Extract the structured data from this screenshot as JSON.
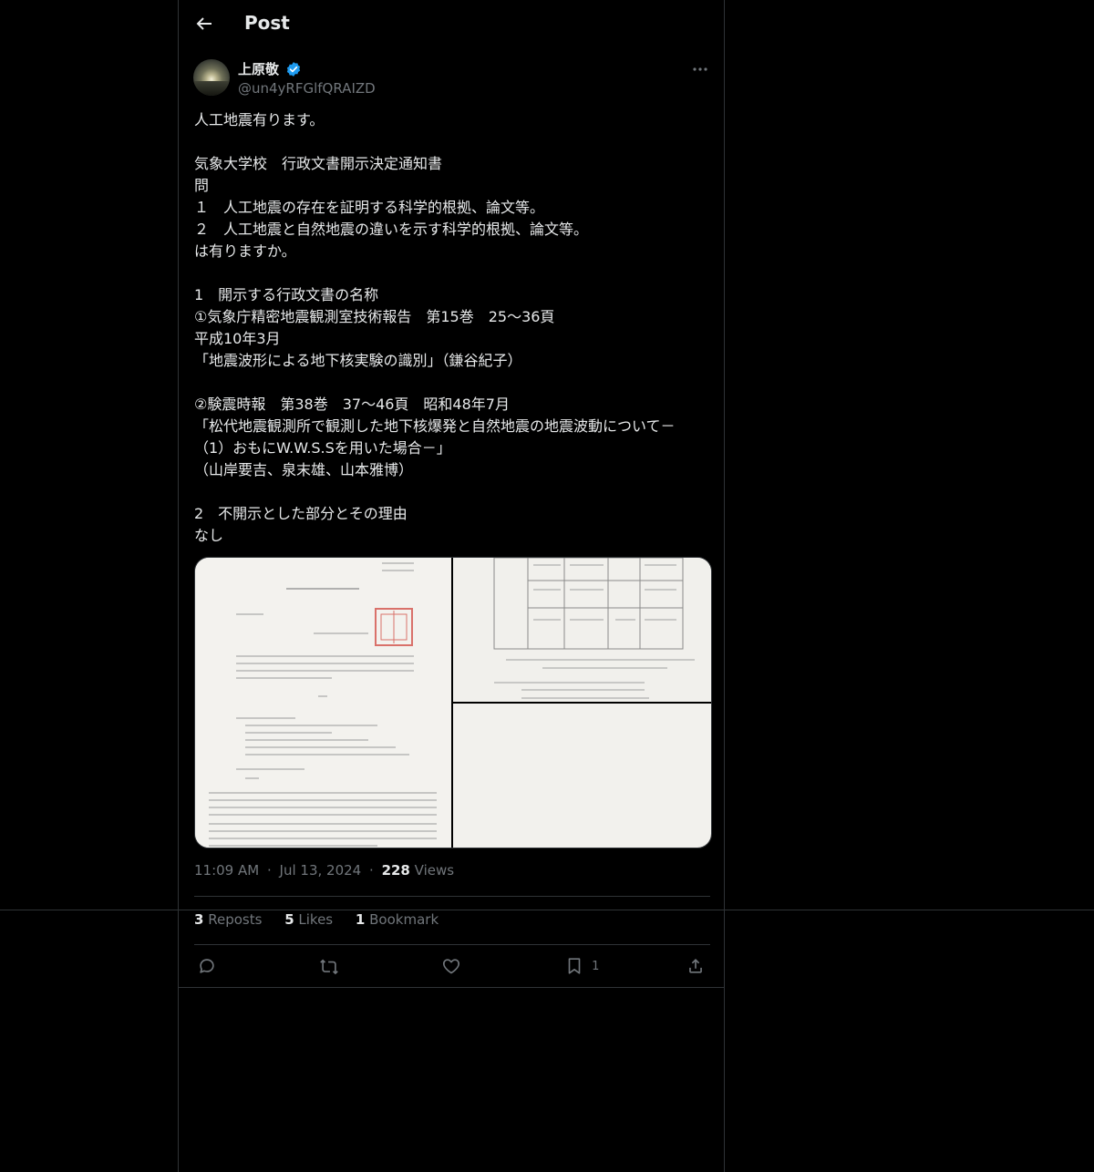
{
  "header": {
    "title": "Post"
  },
  "author": {
    "name": "上原敬",
    "handle": "@un4yRFGlfQRAIZD",
    "verified_color": "#1d9bf0"
  },
  "tweet": {
    "lines": [
      "人工地震有ります。",
      "",
      "気象大学校　行政文書開示決定通知書",
      "問",
      "１　人工地震の存在を証明する科学的根拠、論文等。",
      "２　人工地震と自然地震の違いを示す科学的根拠、論文等。",
      "は有りますか。",
      "",
      "1　開示する行政文書の名称",
      "①気象庁精密地震観測室技術報告　第15巻　25〜36頁",
      "平成10年3月",
      "「地震波形による地下核実験の識別」（鎌谷紀子）",
      "",
      "②験震時報　第38巻　37〜46頁　昭和48年7月",
      "「松代地震観測所で観測した地下核爆発と自然地震の地震波動について－",
      "（1）おもにW.W.S.Sを用いた場合－」",
      "（山岸要吉、泉末雄、山本雅博）",
      "",
      "2　不開示とした部分とその理由",
      "なし"
    ]
  },
  "meta": {
    "time": "11:09 AM",
    "dot1": "·",
    "date": "Jul 13, 2024",
    "dot2": "·",
    "views_count": "228",
    "views_label": "Views"
  },
  "stats": {
    "reposts_count": "3",
    "reposts_label": "Reposts",
    "likes_count": "5",
    "likes_label": "Likes",
    "bookmarks_count": "1",
    "bookmarks_label": "Bookmark"
  },
  "actions": {
    "bookmark_count": "1"
  },
  "icons": {
    "back": "arrow-left-icon",
    "more": "more-icon",
    "reply": "reply-icon",
    "repost": "repost-icon",
    "like": "heart-icon",
    "bookmark": "bookmark-icon",
    "share": "share-icon"
  }
}
